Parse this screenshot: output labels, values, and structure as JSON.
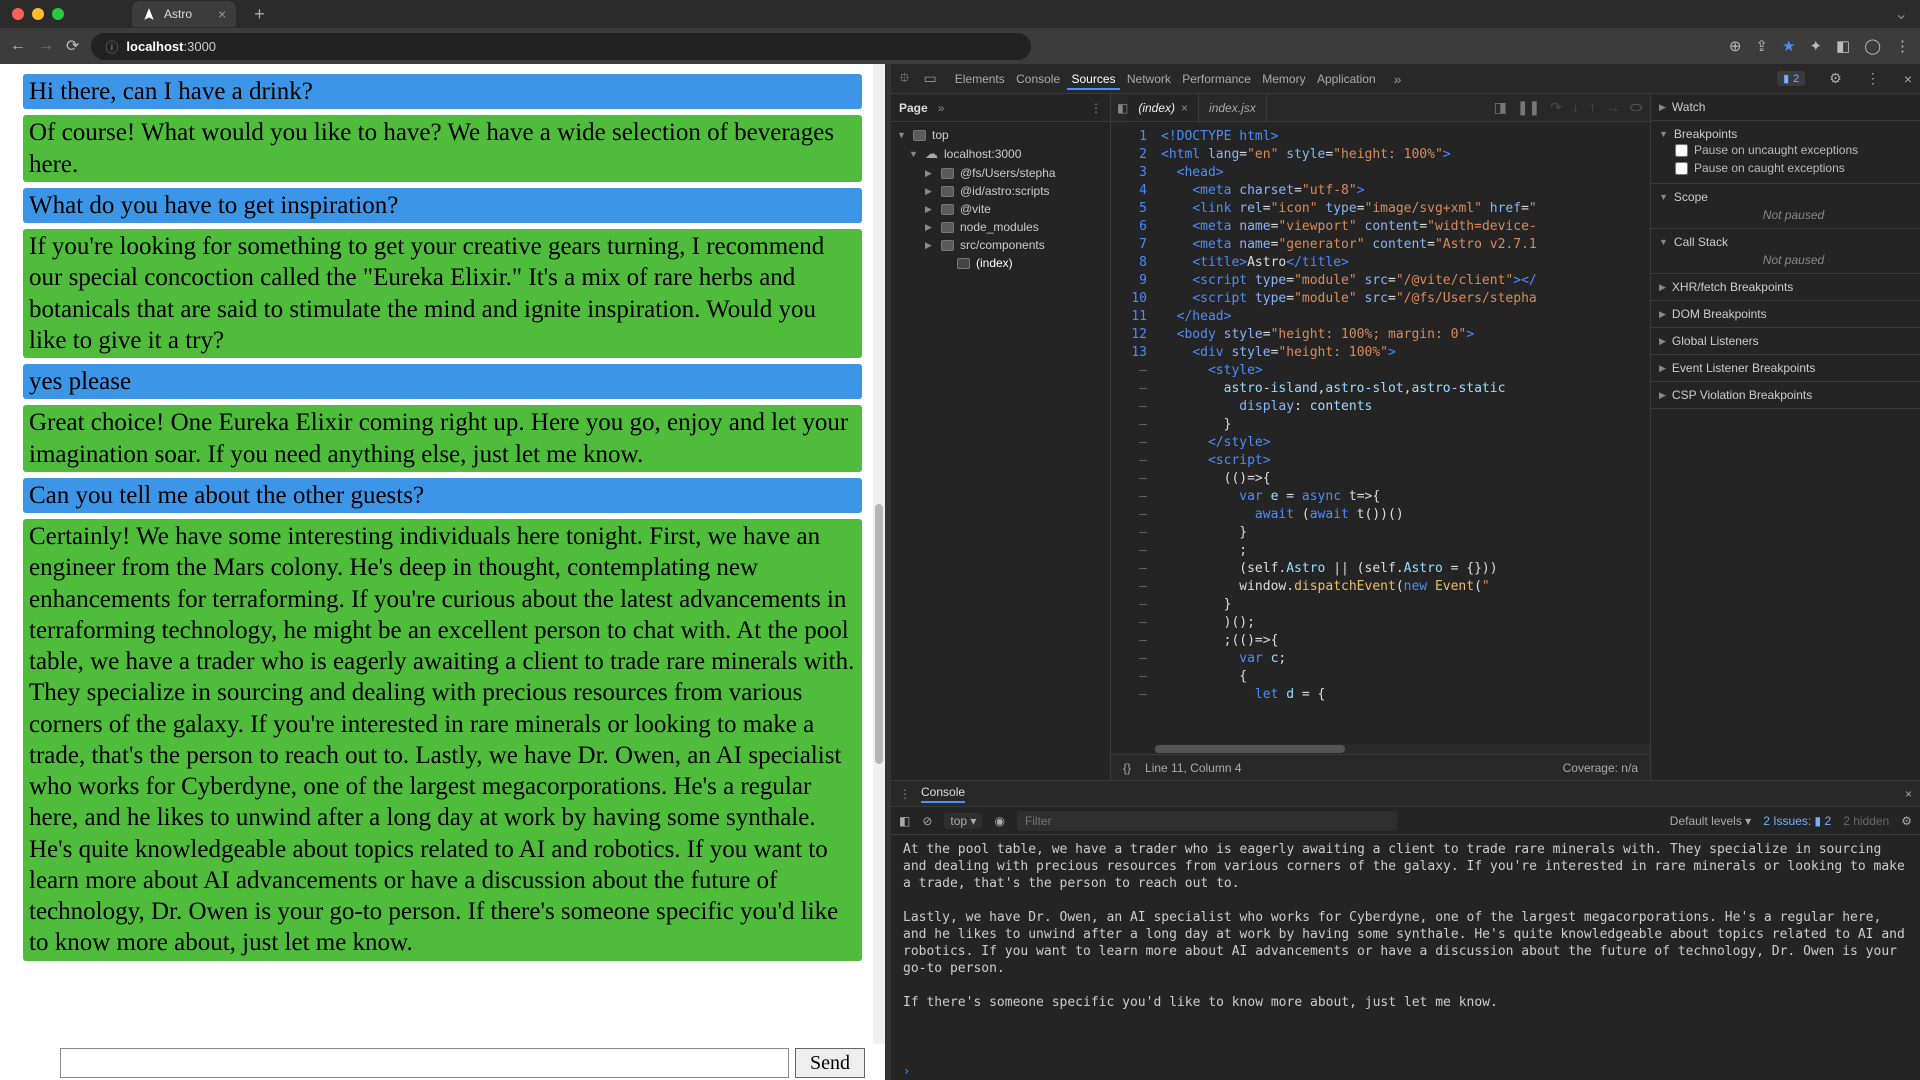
{
  "browser": {
    "tab_title": "Astro",
    "url_host": "localhost",
    "url_rest": ":3000"
  },
  "chat": {
    "messages": [
      {
        "role": "user",
        "text": "Hi there, can I have a drink?"
      },
      {
        "role": "bot",
        "text": "Of course! What would you like to have? We have a wide selection of beverages here."
      },
      {
        "role": "user",
        "text": "What do you have to get inspiration?"
      },
      {
        "role": "bot",
        "text": "If you're looking for something to get your creative gears turning, I recommend our special concoction called the \"Eureka Elixir.\" It's a mix of rare herbs and botanicals that are said to stimulate the mind and ignite inspiration. Would you like to give it a try?"
      },
      {
        "role": "user",
        "text": "yes please"
      },
      {
        "role": "bot",
        "text": "Great choice! One Eureka Elixir coming right up. Here you go, enjoy and let your imagination soar. If you need anything else, just let me know."
      },
      {
        "role": "user",
        "text": "Can you tell me about the other guests?"
      },
      {
        "role": "bot",
        "text": "Certainly! We have some interesting individuals here tonight. First, we have an engineer from the Mars colony. He's deep in thought, contemplating new enhancements for terraforming. If you're curious about the latest advancements in terraforming technology, he might be an excellent person to chat with. At the pool table, we have a trader who is eagerly awaiting a client to trade rare minerals with. They specialize in sourcing and dealing with precious resources from various corners of the galaxy. If you're interested in rare minerals or looking to make a trade, that's the person to reach out to. Lastly, we have Dr. Owen, an AI specialist who works for Cyberdyne, one of the largest megacorporations. He's a regular here, and he likes to unwind after a long day at work by having some synthale. He's quite knowledgeable about topics related to AI and robotics. If you want to learn more about AI advancements or have a discussion about the future of technology, Dr. Owen is your go-to person. If there's someone specific you'd like to know more about, just let me know."
      }
    ],
    "send_label": "Send"
  },
  "devtools": {
    "panels": [
      "Elements",
      "Console",
      "Sources",
      "Network",
      "Performance",
      "Memory",
      "Application"
    ],
    "active_panel": "Sources",
    "issues_badge": "2",
    "nav": {
      "page_label": "Page",
      "top": "top",
      "host": "localhost:3000",
      "folders": [
        "@fs/Users/stepha",
        "@id/astro:scripts",
        "@vite",
        "node_modules",
        "src/components"
      ],
      "file": "(index)"
    },
    "editor": {
      "tabs": [
        {
          "name": "(index)",
          "active": true
        },
        {
          "name": "index.jsx",
          "active": false
        }
      ],
      "status_cursor": "Line 11, Column 4",
      "coverage": "Coverage: n/a"
    },
    "code": {
      "lines": [
        {
          "n": "1",
          "html": "<span class='t-tag'>&lt;!DOCTYPE html&gt;</span>"
        },
        {
          "n": "2",
          "html": "<span class='t-tag'>&lt;html</span> <span class='t-attr'>lang</span>=<span class='t-str'>\"en\"</span> <span class='t-attr'>style</span>=<span class='t-str'>\"height: 100%\"</span><span class='t-tag'>&gt;</span>"
        },
        {
          "n": "3",
          "html": "  <span class='t-tag'>&lt;head&gt;</span>"
        },
        {
          "n": "4",
          "html": "    <span class='t-tag'>&lt;meta</span> <span class='t-attr'>charset</span>=<span class='t-str'>\"utf-8\"</span><span class='t-tag'>&gt;</span>"
        },
        {
          "n": "5",
          "html": "    <span class='t-tag'>&lt;link</span> <span class='t-attr'>rel</span>=<span class='t-str'>\"icon\"</span> <span class='t-attr'>type</span>=<span class='t-str'>\"image/svg+xml\"</span> <span class='t-attr'>href</span>=<span class='t-str'>\"</span>"
        },
        {
          "n": "6",
          "html": "    <span class='t-tag'>&lt;meta</span> <span class='t-attr'>name</span>=<span class='t-str'>\"viewport\"</span> <span class='t-attr'>content</span>=<span class='t-str'>\"width=device-</span>"
        },
        {
          "n": "7",
          "html": "    <span class='t-tag'>&lt;meta</span> <span class='t-attr'>name</span>=<span class='t-str'>\"generator\"</span> <span class='t-attr'>content</span>=<span class='t-str'>\"Astro v2.7.1</span>"
        },
        {
          "n": "8",
          "html": "    <span class='t-tag'>&lt;title&gt;</span>Astro<span class='t-tag'>&lt;/title&gt;</span>"
        },
        {
          "n": "9",
          "html": "    <span class='t-tag'>&lt;script</span> <span class='t-attr'>type</span>=<span class='t-str'>\"module\"</span> <span class='t-attr'>src</span>=<span class='t-str'>\"/@vite/client\"</span><span class='t-tag'>&gt;&lt;/</span>"
        },
        {
          "n": "10",
          "html": "    <span class='t-tag'>&lt;script</span> <span class='t-attr'>type</span>=<span class='t-str'>\"module\"</span> <span class='t-attr'>src</span>=<span class='t-str'>\"/@fs/Users/stepha</span>"
        },
        {
          "n": "11",
          "html": "  <span class='t-tag'>&lt;/head&gt;</span>"
        },
        {
          "n": "12",
          "html": "  <span class='t-tag'>&lt;body</span> <span class='t-attr'>style</span>=<span class='t-str'>\"height: 100%; margin: 0\"</span><span class='t-tag'>&gt;</span>"
        },
        {
          "n": "13",
          "html": "    <span class='t-tag'>&lt;div</span> <span class='t-attr'>style</span>=<span class='t-str'>\"height: 100%\"</span><span class='t-tag'>&gt;</span>"
        },
        {
          "n": "–",
          "html": "      <span class='t-tag'>&lt;style&gt;</span>"
        },
        {
          "n": "–",
          "html": "        <span class='t-id'>astro-island</span>,<span class='t-id'>astro-slot</span>,<span class='t-id'>astro-static</span>"
        },
        {
          "n": "–",
          "html": "          <span class='t-attr'>display</span>: <span class='t-id'>contents</span>"
        },
        {
          "n": "–",
          "html": "        }"
        },
        {
          "n": "–",
          "html": "      <span class='t-tag'>&lt;/style&gt;</span>"
        },
        {
          "n": "–",
          "html": "      <span class='t-tag'>&lt;script&gt;</span>"
        },
        {
          "n": "–",
          "html": "        (()=&gt;{"
        },
        {
          "n": "–",
          "html": "          <span class='t-kw'>var</span> <span class='t-id'>e</span> = <span class='t-kw'>async</span> t=&gt;{"
        },
        {
          "n": "–",
          "html": "            <span class='t-kw'>await</span> (<span class='t-kw'>await</span> t())()"
        },
        {
          "n": "–",
          "html": "          }"
        },
        {
          "n": "–",
          "html": "          ;"
        },
        {
          "n": "–",
          "html": "          (self.<span class='t-id'>Astro</span> || (self.<span class='t-id'>Astro</span> = {})) "
        },
        {
          "n": "–",
          "html": "          window.<span class='t-fn'>dispatchEvent</span>(<span class='t-new'>new</span> <span class='t-fn'>Event</span>(<span class='t-str'>\"</span>"
        },
        {
          "n": "–",
          "html": "        }"
        },
        {
          "n": "–",
          "html": "        )();"
        },
        {
          "n": "–",
          "html": "        ;(()=&gt;{"
        },
        {
          "n": "–",
          "html": "          <span class='t-kw'>var</span> <span class='t-id'>c</span>;"
        },
        {
          "n": "–",
          "html": "          {"
        },
        {
          "n": "–",
          "html": "            <span class='t-kw'>let</span> <span class='t-id'>d</span> = {"
        }
      ]
    },
    "debugger": {
      "sections": {
        "watch": "Watch",
        "breakpoints": "Breakpoints",
        "pause_uncaught": "Pause on uncaught exceptions",
        "pause_caught": "Pause on caught exceptions",
        "scope": "Scope",
        "scope_body": "Not paused",
        "callstack": "Call Stack",
        "callstack_body": "Not paused",
        "xhr": "XHR/fetch Breakpoints",
        "dom": "DOM Breakpoints",
        "global": "Global Listeners",
        "event": "Event Listener Breakpoints",
        "csp": "CSP Violation Breakpoints"
      }
    },
    "console": {
      "label": "Console",
      "context": "top",
      "filter_placeholder": "Filter",
      "levels": "Default levels",
      "issues_label": "2 Issues:",
      "issues_count": "2",
      "hidden": "2 hidden",
      "log1": "At the pool table, we have a trader who is eagerly awaiting a client to trade rare minerals with. They specialize in sourcing and dealing with precious resources from various corners of the galaxy. If you're interested in rare minerals or looking to make a trade, that's the person to reach out to.",
      "log2": "Lastly, we have Dr. Owen, an AI specialist who works for Cyberdyne, one of the largest megacorporations. He's a regular here, and he likes to unwind after a long day at work by having some synthale. He's quite knowledgeable about topics related to AI and robotics. If you want to learn more about AI advancements or have a discussion about the future of technology, Dr. Owen is your go-to person.",
      "log3": "If there's someone specific you'd like to know more about, just let me know."
    }
  }
}
